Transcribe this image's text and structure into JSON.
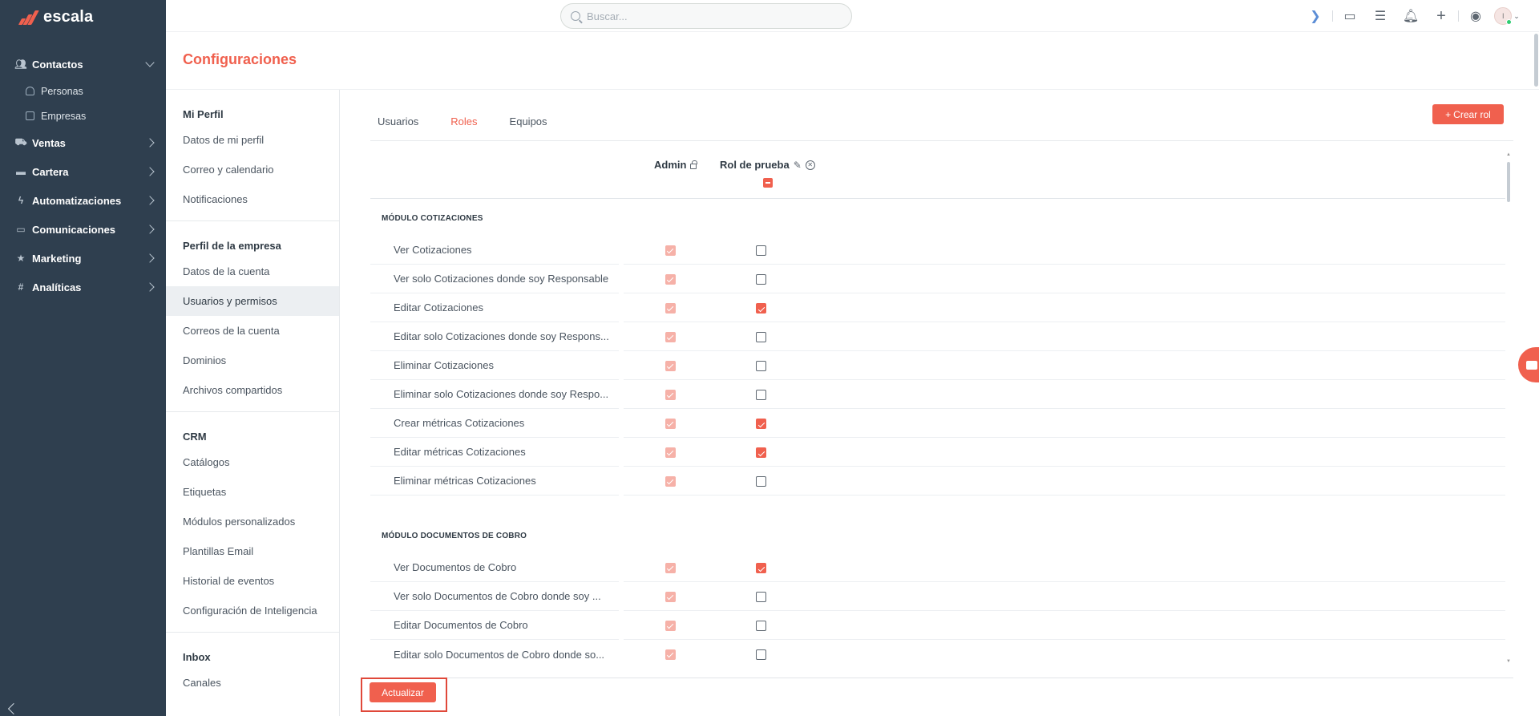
{
  "brand": {
    "name": "escala",
    "trademark": "."
  },
  "colors": {
    "accent": "#f0604e",
    "sidebar_bg": "#2f3f4f"
  },
  "sidebar": {
    "items": [
      {
        "label": "Contactos",
        "icon": "people-icon",
        "expanded": true,
        "children": [
          {
            "label": "Personas",
            "icon": "person-icon"
          },
          {
            "label": "Empresas",
            "icon": "building-icon"
          }
        ]
      },
      {
        "label": "Ventas",
        "icon": "cart-icon"
      },
      {
        "label": "Cartera",
        "icon": "wallet-icon"
      },
      {
        "label": "Automatizaciones",
        "icon": "bolt-icon"
      },
      {
        "label": "Comunicaciones",
        "icon": "chat-icon"
      },
      {
        "label": "Marketing",
        "icon": "star-icon"
      },
      {
        "label": "Analíticas",
        "icon": "hash-icon"
      }
    ]
  },
  "topbar": {
    "search_placeholder": "Buscar...",
    "avatar_initial": "I"
  },
  "page_title": "Configuraciones",
  "settings_menu": {
    "groups": [
      {
        "heading": "Mi Perfil",
        "items": [
          "Datos de mi perfil",
          "Correo y calendario",
          "Notificaciones"
        ]
      },
      {
        "heading": "Perfil de la empresa",
        "items": [
          "Datos de la cuenta",
          "Usuarios y permisos",
          "Correos de la cuenta",
          "Dominios",
          "Archivos compartidos"
        ]
      },
      {
        "heading": "CRM",
        "items": [
          "Catálogos",
          "Etiquetas",
          "Módulos personalizados",
          "Plantillas Email",
          "Historial de eventos",
          "Configuración de Inteligencia"
        ]
      },
      {
        "heading": "Inbox",
        "items": [
          "Canales"
        ]
      }
    ],
    "active_item": "Usuarios y permisos"
  },
  "tabs": [
    {
      "label": "Usuarios",
      "active": false
    },
    {
      "label": "Roles",
      "active": true
    },
    {
      "label": "Equipos",
      "active": false
    }
  ],
  "create_role_button": "Crear rol",
  "roles": {
    "admin_label": "Admin",
    "custom_role_label": "Rol de prueba"
  },
  "sections": [
    {
      "title": "MÓDULO COTIZACIONES",
      "permissions": [
        {
          "label": "Ver Cotizaciones",
          "admin": true,
          "role": false
        },
        {
          "label": "Ver solo Cotizaciones donde soy Responsable",
          "admin": true,
          "role": false
        },
        {
          "label": "Editar Cotizaciones",
          "admin": true,
          "role": true
        },
        {
          "label": "Editar solo Cotizaciones donde soy Respons...",
          "admin": true,
          "role": false
        },
        {
          "label": "Eliminar Cotizaciones",
          "admin": true,
          "role": false
        },
        {
          "label": "Eliminar solo Cotizaciones donde soy Respo...",
          "admin": true,
          "role": false
        },
        {
          "label": "Crear métricas Cotizaciones",
          "admin": true,
          "role": true
        },
        {
          "label": "Editar métricas Cotizaciones",
          "admin": true,
          "role": true
        },
        {
          "label": "Eliminar métricas Cotizaciones",
          "admin": true,
          "role": false
        }
      ]
    },
    {
      "title": "MÓDULO DOCUMENTOS DE COBRO",
      "permissions": [
        {
          "label": "Ver Documentos de Cobro",
          "admin": true,
          "role": true
        },
        {
          "label": "Ver solo Documentos de Cobro donde soy ...",
          "admin": true,
          "role": false
        },
        {
          "label": "Editar Documentos de Cobro",
          "admin": true,
          "role": false
        },
        {
          "label": "Editar solo Documentos de Cobro donde so...",
          "admin": true,
          "role": false
        }
      ]
    }
  ],
  "update_button": "Actualizar"
}
